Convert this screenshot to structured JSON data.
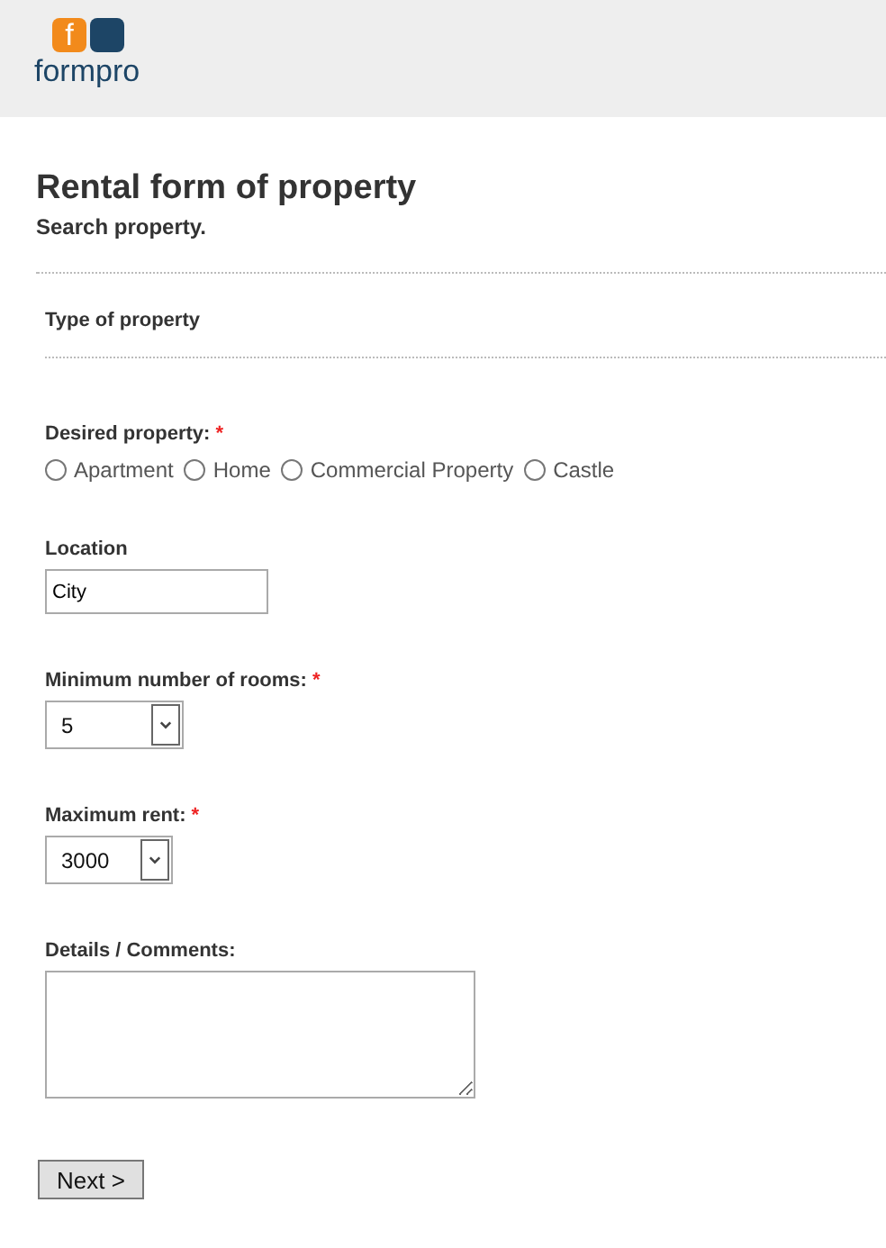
{
  "logo": {
    "mark": "f",
    "name": "formpro"
  },
  "form": {
    "title": "Rental form of property",
    "subtitle": "Search property.",
    "section": "Type of property"
  },
  "fields": [
    {
      "kind": "radio",
      "label": "Desired property:",
      "required_mark": "*",
      "options": [
        {
          "label": "Apartment",
          "selected": false
        },
        {
          "label": "Home",
          "selected": false
        },
        {
          "label": "Commercial Property",
          "selected": false
        },
        {
          "label": "Castle",
          "selected": false
        }
      ]
    },
    {
      "kind": "text",
      "label": "Location",
      "value": "City"
    },
    {
      "kind": "select",
      "label": "Minimum number of rooms:",
      "required_mark": "*",
      "value": "5"
    },
    {
      "kind": "select",
      "label": "Maximum rent:",
      "required_mark": "*",
      "value": "3000"
    },
    {
      "kind": "textarea",
      "label": "Details / Comments:"
    }
  ],
  "button": "Next >"
}
